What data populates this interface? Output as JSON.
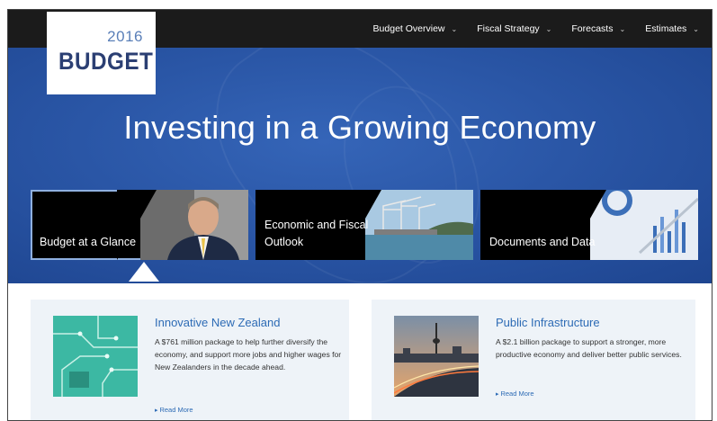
{
  "logo": {
    "year": "2016",
    "word": "BUDGET"
  },
  "nav": {
    "items": [
      {
        "label": "Budget Overview",
        "chevron": "⌄"
      },
      {
        "label": "Fiscal Strategy",
        "chevron": "⌄"
      },
      {
        "label": "Forecasts",
        "chevron": "⌄"
      },
      {
        "label": "Estimates",
        "chevron": "⌄"
      }
    ]
  },
  "hero": {
    "title": "Investing in a Growing Economy"
  },
  "tiles": [
    {
      "label": "Budget at a Glance",
      "photo": "portrait-photo"
    },
    {
      "label": "Economic and Fiscal Outlook",
      "photo": "port-cranes-photo"
    },
    {
      "label": "Documents and Data",
      "photo": "charts-photo"
    }
  ],
  "cards": [
    {
      "title": "Innovative New Zealand",
      "text": "A $761 million package to help further diversify the economy, and support more jobs and higher wages for New Zealanders in the decade ahead.",
      "link": "Read More",
      "image": "circuit-board-image"
    },
    {
      "title": "Public Infrastructure",
      "text": "A $2.1 billion package to support a stronger, more productive economy and deliver better public services.",
      "link": "Read More",
      "image": "city-motorway-image"
    }
  ],
  "colors": {
    "nav_bg": "#1b1b1b",
    "hero_blue": "#2a56a6",
    "logo_navy": "#2b3f73",
    "link_blue": "#2d6bb5",
    "card_bg": "#eef3f8"
  }
}
